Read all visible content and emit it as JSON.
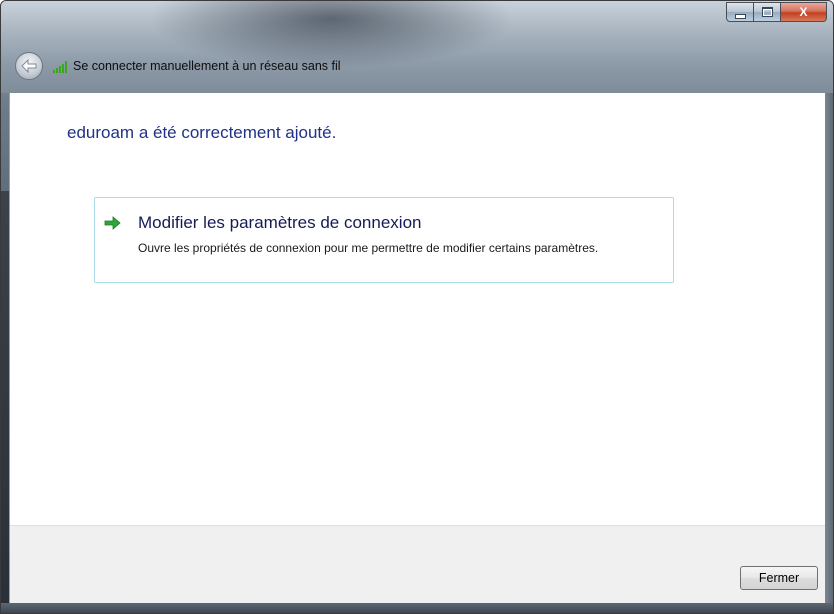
{
  "window": {
    "title": "Se connecter manuellement à un réseau sans fil",
    "icons": {
      "back": "back-arrow-icon",
      "network": "wireless-signal-icon",
      "minimize": "minimize-icon",
      "maximize": "maximize-icon",
      "close": "close-icon"
    },
    "close_glyph": "X"
  },
  "main": {
    "heading": "eduroam a été correctement ajouté.",
    "command_link": {
      "icon": "green-arrow-icon",
      "title": "Modifier les paramètres de connexion",
      "description": "Ouvre les propriétés de connexion pour me permettre de modifier certains paramètres."
    }
  },
  "footer": {
    "close_button_label": "Fermer"
  },
  "colors": {
    "heading": "#1e3287",
    "command_border": "#a9dbe8",
    "arrow": "#2fa43c",
    "close_button": "#c2401f"
  }
}
